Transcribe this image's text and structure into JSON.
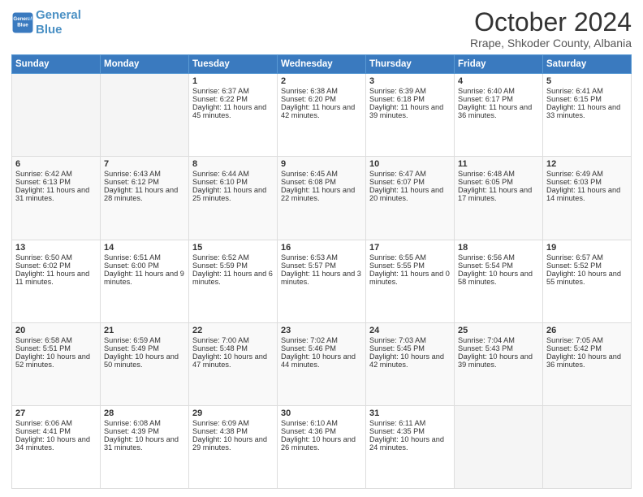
{
  "header": {
    "logo_line1": "General",
    "logo_line2": "Blue",
    "title": "October 2024",
    "subtitle": "Rrape, Shkoder County, Albania"
  },
  "days_of_week": [
    "Sunday",
    "Monday",
    "Tuesday",
    "Wednesday",
    "Thursday",
    "Friday",
    "Saturday"
  ],
  "weeks": [
    [
      {
        "day": "",
        "sunrise": "",
        "sunset": "",
        "daylight": ""
      },
      {
        "day": "",
        "sunrise": "",
        "sunset": "",
        "daylight": ""
      },
      {
        "day": "1",
        "sunrise": "Sunrise: 6:37 AM",
        "sunset": "Sunset: 6:22 PM",
        "daylight": "Daylight: 11 hours and 45 minutes."
      },
      {
        "day": "2",
        "sunrise": "Sunrise: 6:38 AM",
        "sunset": "Sunset: 6:20 PM",
        "daylight": "Daylight: 11 hours and 42 minutes."
      },
      {
        "day": "3",
        "sunrise": "Sunrise: 6:39 AM",
        "sunset": "Sunset: 6:18 PM",
        "daylight": "Daylight: 11 hours and 39 minutes."
      },
      {
        "day": "4",
        "sunrise": "Sunrise: 6:40 AM",
        "sunset": "Sunset: 6:17 PM",
        "daylight": "Daylight: 11 hours and 36 minutes."
      },
      {
        "day": "5",
        "sunrise": "Sunrise: 6:41 AM",
        "sunset": "Sunset: 6:15 PM",
        "daylight": "Daylight: 11 hours and 33 minutes."
      }
    ],
    [
      {
        "day": "6",
        "sunrise": "Sunrise: 6:42 AM",
        "sunset": "Sunset: 6:13 PM",
        "daylight": "Daylight: 11 hours and 31 minutes."
      },
      {
        "day": "7",
        "sunrise": "Sunrise: 6:43 AM",
        "sunset": "Sunset: 6:12 PM",
        "daylight": "Daylight: 11 hours and 28 minutes."
      },
      {
        "day": "8",
        "sunrise": "Sunrise: 6:44 AM",
        "sunset": "Sunset: 6:10 PM",
        "daylight": "Daylight: 11 hours and 25 minutes."
      },
      {
        "day": "9",
        "sunrise": "Sunrise: 6:45 AM",
        "sunset": "Sunset: 6:08 PM",
        "daylight": "Daylight: 11 hours and 22 minutes."
      },
      {
        "day": "10",
        "sunrise": "Sunrise: 6:47 AM",
        "sunset": "Sunset: 6:07 PM",
        "daylight": "Daylight: 11 hours and 20 minutes."
      },
      {
        "day": "11",
        "sunrise": "Sunrise: 6:48 AM",
        "sunset": "Sunset: 6:05 PM",
        "daylight": "Daylight: 11 hours and 17 minutes."
      },
      {
        "day": "12",
        "sunrise": "Sunrise: 6:49 AM",
        "sunset": "Sunset: 6:03 PM",
        "daylight": "Daylight: 11 hours and 14 minutes."
      }
    ],
    [
      {
        "day": "13",
        "sunrise": "Sunrise: 6:50 AM",
        "sunset": "Sunset: 6:02 PM",
        "daylight": "Daylight: 11 hours and 11 minutes."
      },
      {
        "day": "14",
        "sunrise": "Sunrise: 6:51 AM",
        "sunset": "Sunset: 6:00 PM",
        "daylight": "Daylight: 11 hours and 9 minutes."
      },
      {
        "day": "15",
        "sunrise": "Sunrise: 6:52 AM",
        "sunset": "Sunset: 5:59 PM",
        "daylight": "Daylight: 11 hours and 6 minutes."
      },
      {
        "day": "16",
        "sunrise": "Sunrise: 6:53 AM",
        "sunset": "Sunset: 5:57 PM",
        "daylight": "Daylight: 11 hours and 3 minutes."
      },
      {
        "day": "17",
        "sunrise": "Sunrise: 6:55 AM",
        "sunset": "Sunset: 5:55 PM",
        "daylight": "Daylight: 11 hours and 0 minutes."
      },
      {
        "day": "18",
        "sunrise": "Sunrise: 6:56 AM",
        "sunset": "Sunset: 5:54 PM",
        "daylight": "Daylight: 10 hours and 58 minutes."
      },
      {
        "day": "19",
        "sunrise": "Sunrise: 6:57 AM",
        "sunset": "Sunset: 5:52 PM",
        "daylight": "Daylight: 10 hours and 55 minutes."
      }
    ],
    [
      {
        "day": "20",
        "sunrise": "Sunrise: 6:58 AM",
        "sunset": "Sunset: 5:51 PM",
        "daylight": "Daylight: 10 hours and 52 minutes."
      },
      {
        "day": "21",
        "sunrise": "Sunrise: 6:59 AM",
        "sunset": "Sunset: 5:49 PM",
        "daylight": "Daylight: 10 hours and 50 minutes."
      },
      {
        "day": "22",
        "sunrise": "Sunrise: 7:00 AM",
        "sunset": "Sunset: 5:48 PM",
        "daylight": "Daylight: 10 hours and 47 minutes."
      },
      {
        "day": "23",
        "sunrise": "Sunrise: 7:02 AM",
        "sunset": "Sunset: 5:46 PM",
        "daylight": "Daylight: 10 hours and 44 minutes."
      },
      {
        "day": "24",
        "sunrise": "Sunrise: 7:03 AM",
        "sunset": "Sunset: 5:45 PM",
        "daylight": "Daylight: 10 hours and 42 minutes."
      },
      {
        "day": "25",
        "sunrise": "Sunrise: 7:04 AM",
        "sunset": "Sunset: 5:43 PM",
        "daylight": "Daylight: 10 hours and 39 minutes."
      },
      {
        "day": "26",
        "sunrise": "Sunrise: 7:05 AM",
        "sunset": "Sunset: 5:42 PM",
        "daylight": "Daylight: 10 hours and 36 minutes."
      }
    ],
    [
      {
        "day": "27",
        "sunrise": "Sunrise: 6:06 AM",
        "sunset": "Sunset: 4:41 PM",
        "daylight": "Daylight: 10 hours and 34 minutes."
      },
      {
        "day": "28",
        "sunrise": "Sunrise: 6:08 AM",
        "sunset": "Sunset: 4:39 PM",
        "daylight": "Daylight: 10 hours and 31 minutes."
      },
      {
        "day": "29",
        "sunrise": "Sunrise: 6:09 AM",
        "sunset": "Sunset: 4:38 PM",
        "daylight": "Daylight: 10 hours and 29 minutes."
      },
      {
        "day": "30",
        "sunrise": "Sunrise: 6:10 AM",
        "sunset": "Sunset: 4:36 PM",
        "daylight": "Daylight: 10 hours and 26 minutes."
      },
      {
        "day": "31",
        "sunrise": "Sunrise: 6:11 AM",
        "sunset": "Sunset: 4:35 PM",
        "daylight": "Daylight: 10 hours and 24 minutes."
      },
      {
        "day": "",
        "sunrise": "",
        "sunset": "",
        "daylight": ""
      },
      {
        "day": "",
        "sunrise": "",
        "sunset": "",
        "daylight": ""
      }
    ]
  ]
}
